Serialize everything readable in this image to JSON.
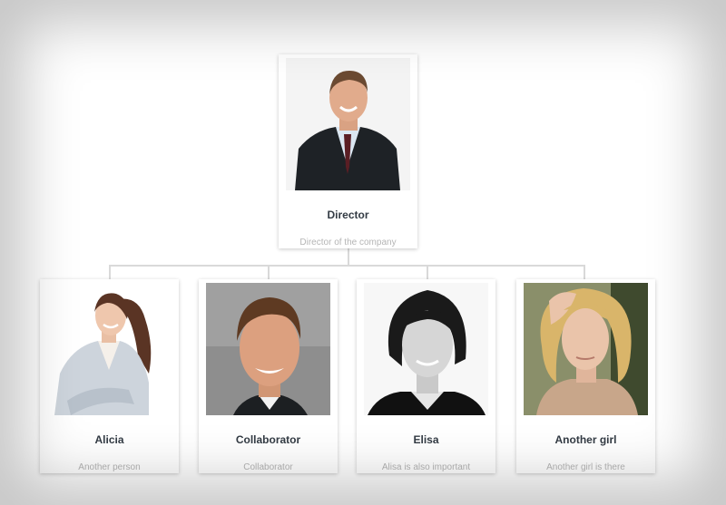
{
  "director": {
    "name": "Director",
    "role": "Director of the company",
    "photo_icon": "man-in-suit-portrait"
  },
  "team": [
    {
      "name": "Alicia",
      "role": "Another person",
      "photo_icon": "woman-business-portrait"
    },
    {
      "name": "Collaborator",
      "role": "Collaborator",
      "photo_icon": "young-man-portrait"
    },
    {
      "name": "Elisa",
      "role": "Alisa is also important",
      "photo_icon": "woman-dark-hair-portrait"
    },
    {
      "name": "Another girl",
      "role": "Another girl is there",
      "photo_icon": "blonde-woman-portrait"
    }
  ],
  "colors": {
    "connector": "#d9d9d9",
    "name_text": "#333b44",
    "role_text": "#b5b5b5"
  }
}
